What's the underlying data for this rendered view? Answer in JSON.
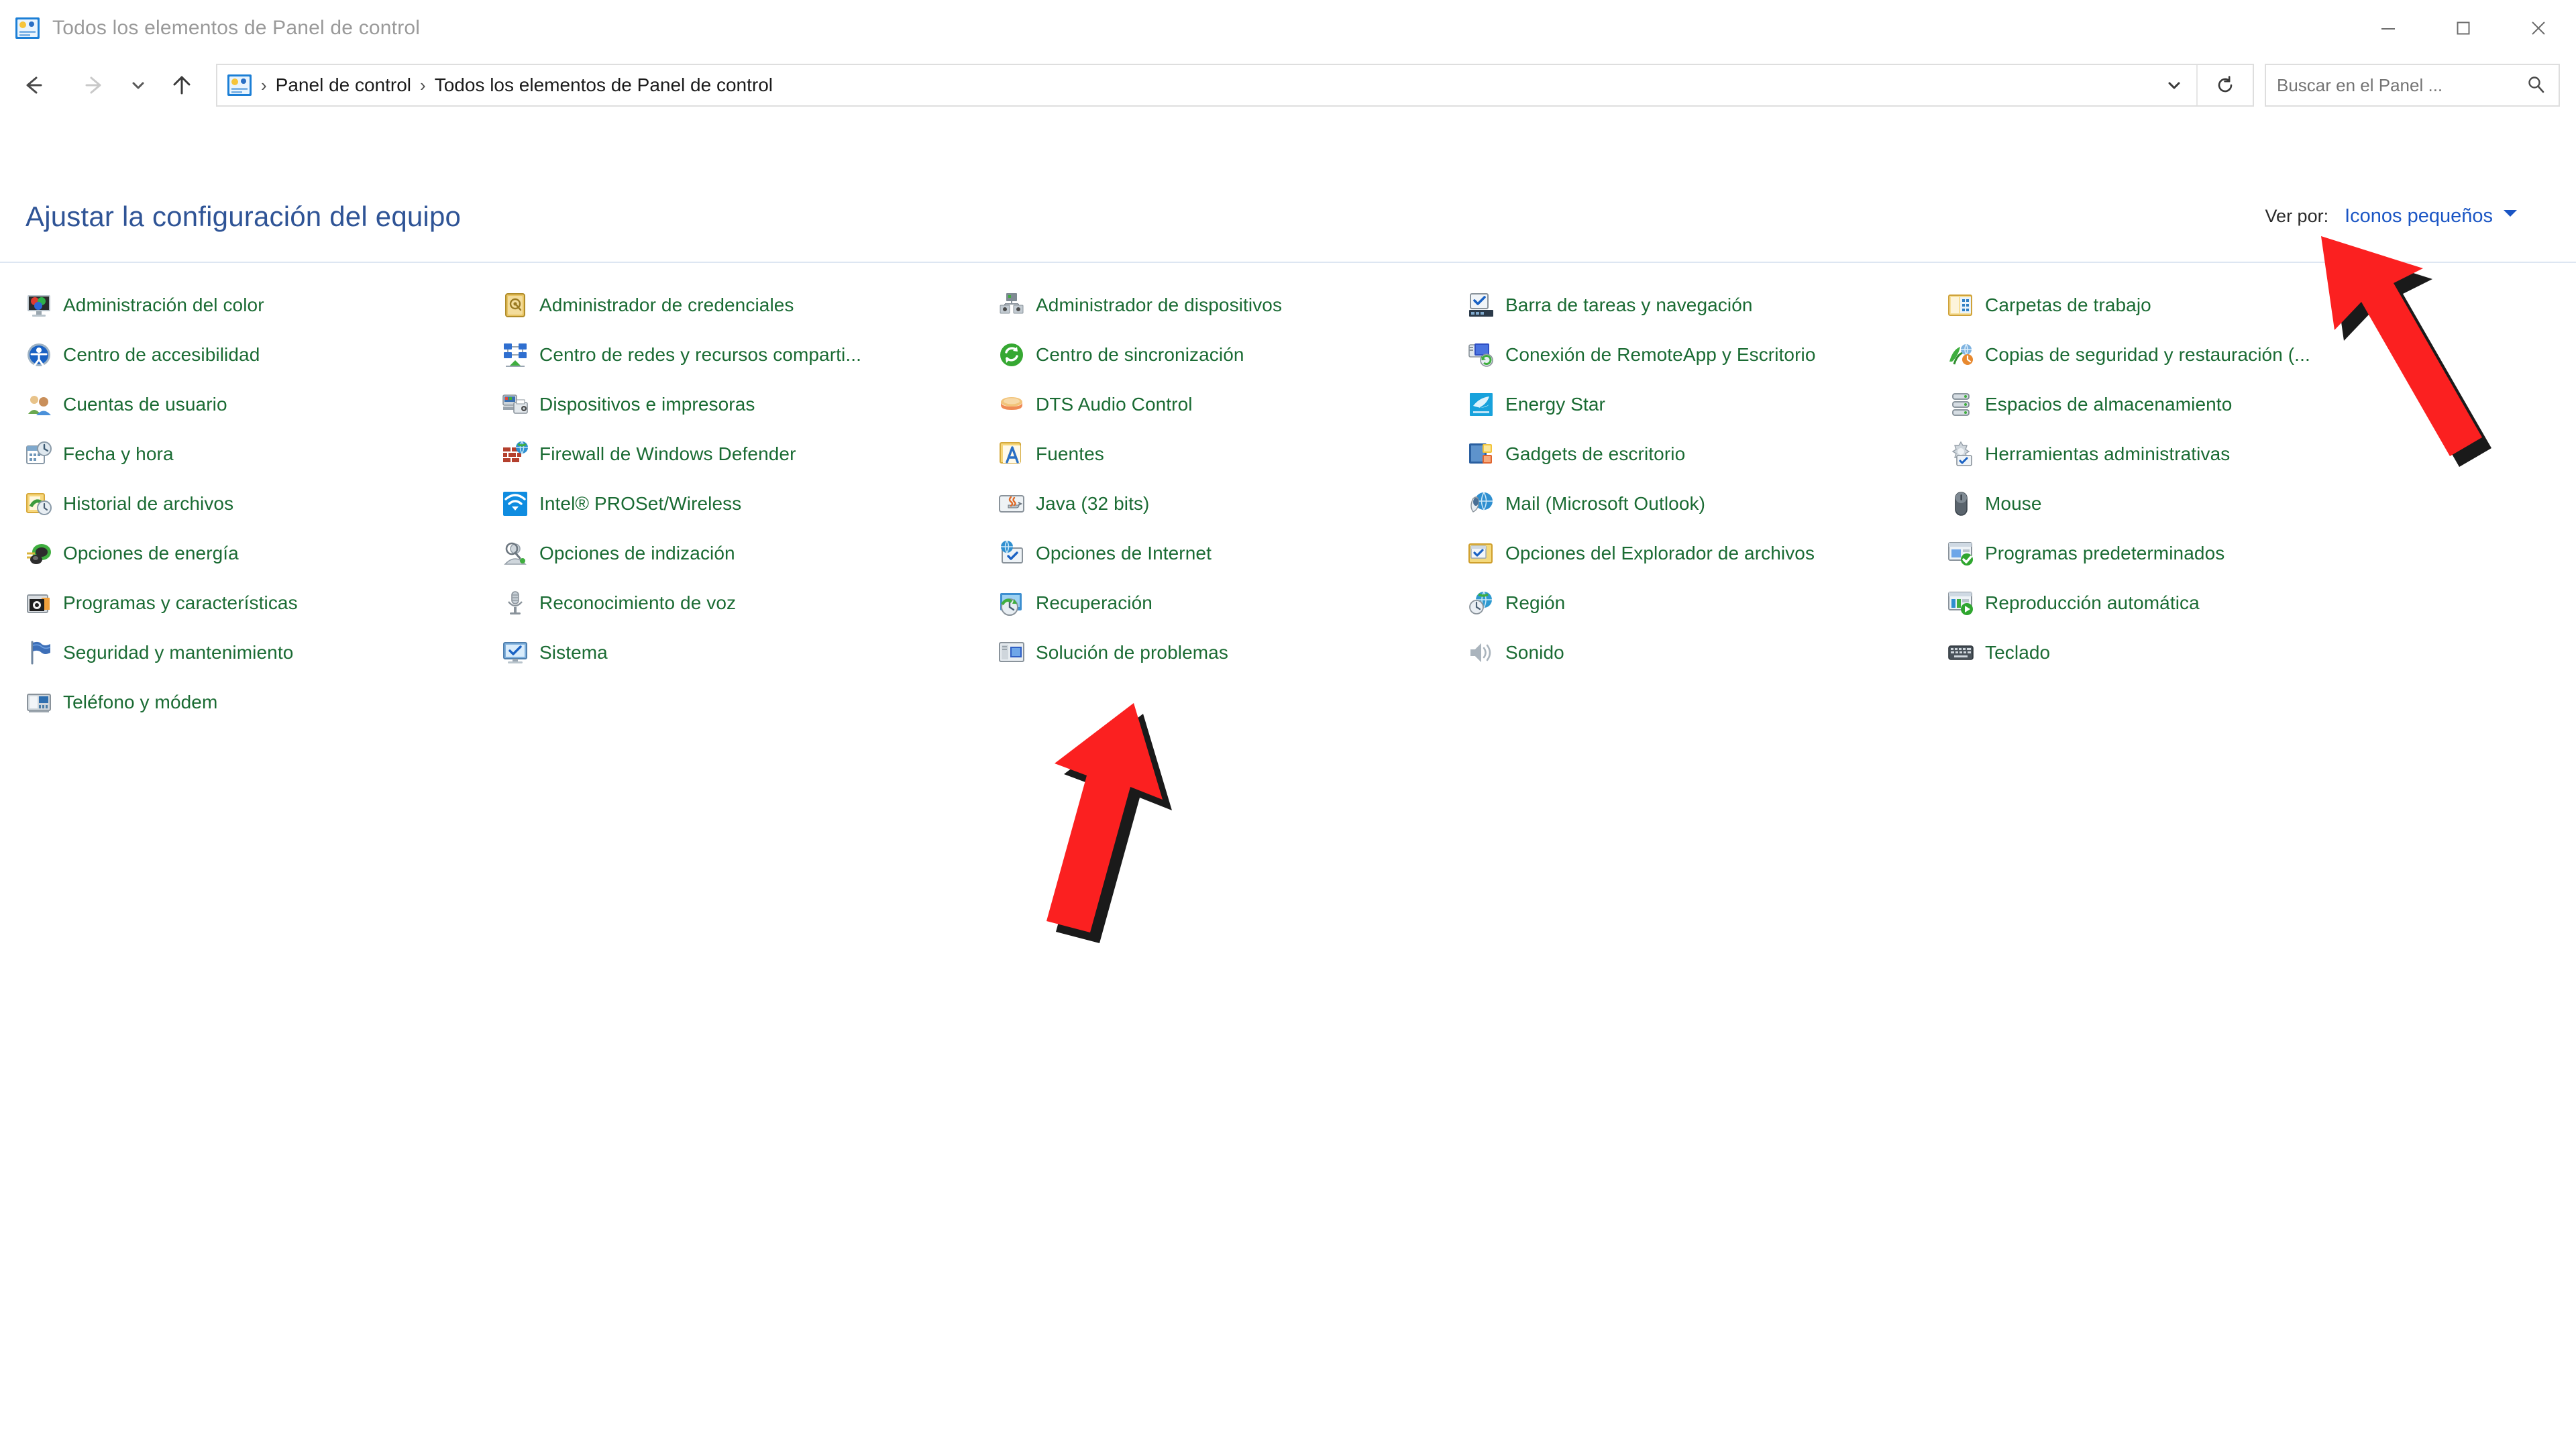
{
  "window": {
    "title": "Todos los elementos de Panel de control",
    "app_icon": "control-panel-icon",
    "controls": {
      "minimize": "Minimizar",
      "maximize": "Maximizar",
      "close": "Cerrar"
    }
  },
  "nav": {
    "back": "Atrás",
    "forward": "Adelante",
    "recent": "Ubicaciones recientes",
    "up": "Subir un nivel",
    "dropdown": "Historial de direcciones",
    "refresh": "Actualizar"
  },
  "address": {
    "icon": "control-panel-icon",
    "separator": "›",
    "crumbs": [
      "Panel de control",
      "Todos los elementos de Panel de control"
    ]
  },
  "search": {
    "placeholder": "Buscar en el Panel ...",
    "value": "",
    "icon": "search-icon"
  },
  "header": {
    "page_title": "Ajustar la configuración del equipo",
    "view_by_label": "Ver por:",
    "view_by_value": "Iconos pequeños",
    "view_by_caret": "caret-down-icon"
  },
  "colors": {
    "page_title": "#2f5496",
    "item_label": "#1a6b33",
    "link": "#1a55c4",
    "divider": "#dde6f2",
    "annotation_arrow": "#fb2020",
    "annotation_shadow": "#1a1a1a"
  },
  "columns": [
    {
      "index": 1,
      "items": [
        {
          "label": "Administración del color",
          "icon": "color-management-icon"
        },
        {
          "label": "Centro de accesibilidad",
          "icon": "ease-of-access-icon"
        },
        {
          "label": "Cuentas de usuario",
          "icon": "user-accounts-icon"
        },
        {
          "label": "Fecha y hora",
          "icon": "date-time-icon"
        },
        {
          "label": "Historial de archivos",
          "icon": "file-history-icon"
        },
        {
          "label": "Opciones de energía",
          "icon": "power-options-icon"
        },
        {
          "label": "Programas y características",
          "icon": "programs-features-icon"
        },
        {
          "label": "Seguridad y mantenimiento",
          "icon": "security-maintenance-flag-icon"
        },
        {
          "label": "Teléfono y módem",
          "icon": "phone-modem-icon"
        }
      ]
    },
    {
      "index": 2,
      "items": [
        {
          "label": "Administrador de credenciales",
          "icon": "credential-manager-icon"
        },
        {
          "label": "Centro de redes y recursos comparti...",
          "icon": "network-sharing-center-icon"
        },
        {
          "label": "Dispositivos e impresoras",
          "icon": "devices-printers-icon"
        },
        {
          "label": "Firewall de Windows Defender",
          "icon": "firewall-icon"
        },
        {
          "label": "Intel® PROSet/Wireless",
          "icon": "intel-wireless-icon"
        },
        {
          "label": "Opciones de indización",
          "icon": "indexing-options-icon"
        },
        {
          "label": "Reconocimiento de voz",
          "icon": "speech-recognition-icon"
        },
        {
          "label": "Sistema",
          "icon": "system-icon"
        }
      ]
    },
    {
      "index": 3,
      "items": [
        {
          "label": "Administrador de dispositivos",
          "icon": "device-manager-icon"
        },
        {
          "label": "Centro de sincronización",
          "icon": "sync-center-icon"
        },
        {
          "label": "DTS Audio Control",
          "icon": "dts-audio-icon"
        },
        {
          "label": "Fuentes",
          "icon": "fonts-icon"
        },
        {
          "label": "Java (32 bits)",
          "icon": "java-icon"
        },
        {
          "label": "Opciones de Internet",
          "icon": "internet-options-icon"
        },
        {
          "label": "Recuperación",
          "icon": "recovery-icon"
        },
        {
          "label": "Solución de problemas",
          "icon": "troubleshooting-icon"
        }
      ]
    },
    {
      "index": 4,
      "items": [
        {
          "label": "Barra de tareas y navegación",
          "icon": "taskbar-navigation-icon"
        },
        {
          "label": "Conexión de RemoteApp y Escritorio",
          "icon": "remoteapp-desktop-icon"
        },
        {
          "label": "Energy Star",
          "icon": "energy-star-icon"
        },
        {
          "label": "Gadgets de escritorio",
          "icon": "desktop-gadgets-icon"
        },
        {
          "label": "Mail (Microsoft Outlook)",
          "icon": "mail-outlook-icon"
        },
        {
          "label": "Opciones del Explorador de archivos",
          "icon": "file-explorer-options-icon"
        },
        {
          "label": "Región",
          "icon": "region-icon"
        },
        {
          "label": "Sonido",
          "icon": "sound-icon"
        }
      ]
    },
    {
      "index": 5,
      "items": [
        {
          "label": "Carpetas de trabajo",
          "icon": "work-folders-icon"
        },
        {
          "label": "Copias de seguridad y restauración (...",
          "icon": "backup-restore-icon"
        },
        {
          "label": "Espacios de almacenamiento",
          "icon": "storage-spaces-icon"
        },
        {
          "label": "Herramientas administrativas",
          "icon": "administrative-tools-icon"
        },
        {
          "label": "Mouse",
          "icon": "mouse-icon"
        },
        {
          "label": "Programas predeterminados",
          "icon": "default-programs-icon"
        },
        {
          "label": "Reproducción automática",
          "icon": "autoplay-icon"
        },
        {
          "label": "Teclado",
          "icon": "keyboard-icon"
        }
      ]
    }
  ],
  "annotations": [
    {
      "name": "arrow-pointing-to-view-by",
      "target": "Iconos pequeños"
    },
    {
      "name": "arrow-pointing-to-troubleshooting",
      "target": "Solución de problemas"
    }
  ]
}
